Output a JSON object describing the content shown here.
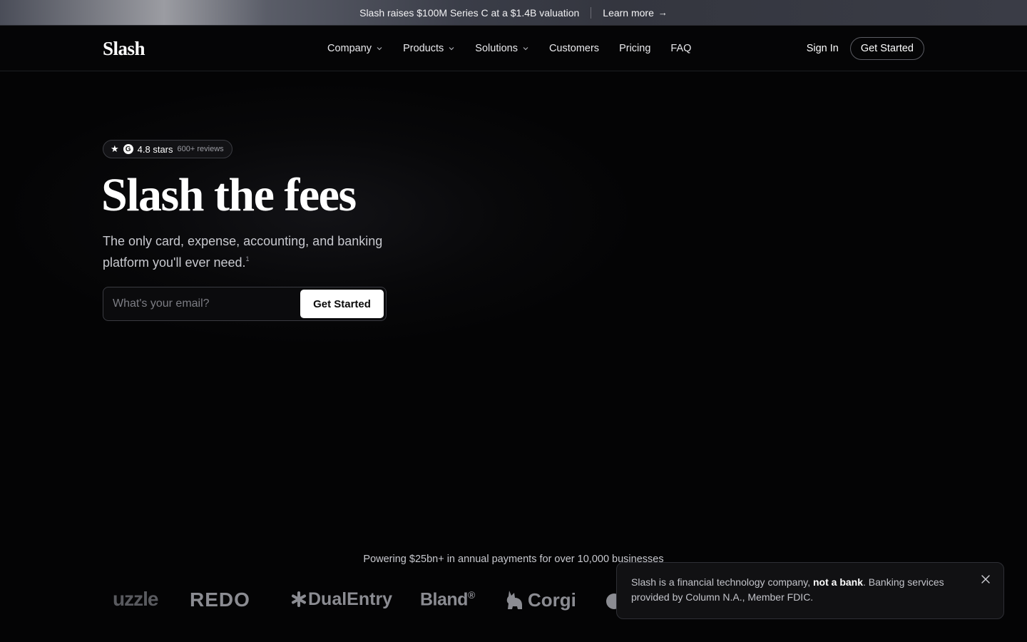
{
  "announcement": {
    "message": "Slash raises $100M Series C at a $1.4B valuation",
    "link_label": "Learn more",
    "arrow": "→"
  },
  "nav": {
    "logo": "Slash",
    "links": [
      {
        "label": "Company",
        "has_dropdown": true
      },
      {
        "label": "Products",
        "has_dropdown": true
      },
      {
        "label": "Solutions",
        "has_dropdown": true
      },
      {
        "label": "Customers",
        "has_dropdown": false
      },
      {
        "label": "Pricing",
        "has_dropdown": false
      },
      {
        "label": "FAQ",
        "has_dropdown": false
      }
    ],
    "sign_in": "Sign In",
    "get_started": "Get Started"
  },
  "hero": {
    "rating": {
      "star_icon": "★",
      "google_icon": "G",
      "stars": "4.8 stars",
      "reviews": "600+ reviews"
    },
    "title": "Slash the fees",
    "subtitle": "The only card, expense, accounting, and banking platform you'll ever need.",
    "footnote": "1",
    "email_placeholder": "What's your email?",
    "cta": "Get Started"
  },
  "social_proof": {
    "powering_text": "Powering $25bn+ in annual payments for over 10,000 businesses",
    "brands": {
      "puzzle": "uzzle",
      "redo": "REDO",
      "dualentry": "DualEntry",
      "bland": "Bland",
      "bland_mark": "®",
      "corgi": "Corgi"
    }
  },
  "notice": {
    "text_before": "Slash is a financial technology company, ",
    "text_bold": "not a bank",
    "text_after": ". Banking services provided by Column N.A., Member FDIC."
  },
  "colors": {
    "background": "#040405",
    "text": "#ffffff",
    "muted": "#c8c9cf",
    "logo_gray": "#8b8c92"
  }
}
